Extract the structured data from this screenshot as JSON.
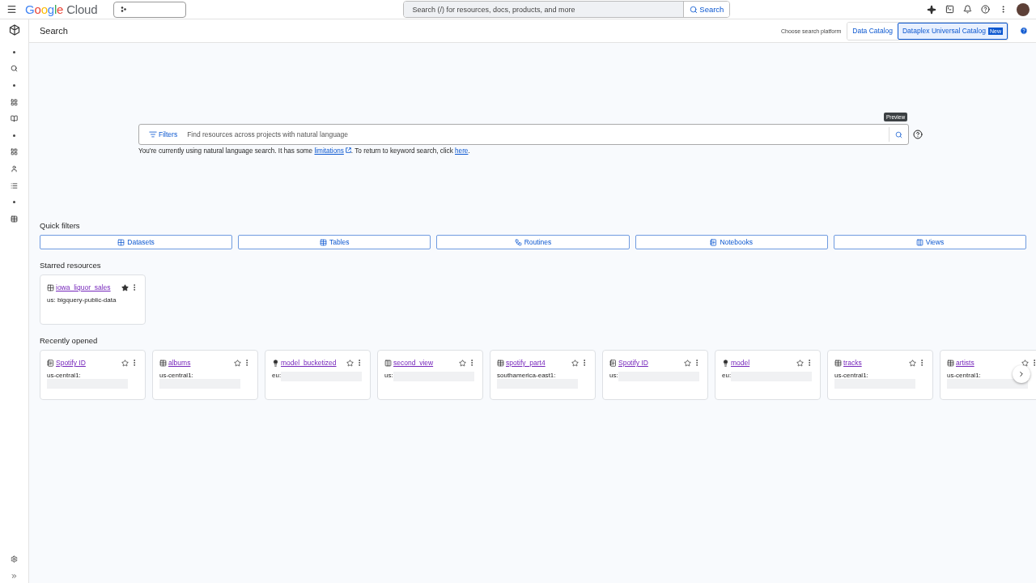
{
  "topbar": {
    "logo": [
      {
        "text": "G",
        "color": "#4285f4"
      },
      {
        "text": "o",
        "color": "#ea4335"
      },
      {
        "text": "o",
        "color": "#fbbc04"
      },
      {
        "text": "g",
        "color": "#4285f4"
      },
      {
        "text": "l",
        "color": "#34a853"
      },
      {
        "text": "e",
        "color": "#ea4335"
      }
    ],
    "logo_suffix": "Cloud",
    "search_placeholder": "Search (/) for resources, docs, products, and more",
    "search_button": "Search"
  },
  "sidebar": [
    {
      "kind": "dot"
    },
    {
      "kind": "search"
    },
    {
      "kind": "dot"
    },
    {
      "kind": "grid"
    },
    {
      "kind": "book"
    },
    {
      "kind": "dot"
    },
    {
      "kind": "grid"
    },
    {
      "kind": "person"
    },
    {
      "kind": "list"
    },
    {
      "kind": "dot"
    },
    {
      "kind": "table"
    }
  ],
  "header": {
    "title": "Search",
    "platform_label": "Choose search platform",
    "platforms": [
      {
        "label": "Data Catalog",
        "selected": false
      },
      {
        "label": "Dataplex Universal Catalog",
        "selected": true,
        "badge": "New"
      }
    ]
  },
  "search": {
    "tooltip": "Preview",
    "filters_label": "Filters",
    "placeholder": "Find resources across projects with natural language",
    "note_before": "You're currently using natural language search. It has some ",
    "note_link": "limitations",
    "note_middle": ". To return to keyword search, click ",
    "note_link2": "here",
    "note_after": "."
  },
  "quick_filters": {
    "title": "Quick filters",
    "items": [
      {
        "label": "Datasets",
        "kind": "dataset"
      },
      {
        "label": "Tables",
        "kind": "table"
      },
      {
        "label": "Routines",
        "kind": "routine"
      },
      {
        "label": "Notebooks",
        "kind": "notebook"
      },
      {
        "label": "Views",
        "kind": "view"
      }
    ]
  },
  "starred": {
    "title": "Starred resources",
    "items": [
      {
        "name": "iowa_liquor_sales",
        "kind": "dataset",
        "starred": true,
        "location": "us: bigquery-public-data"
      }
    ]
  },
  "recent": {
    "title": "Recently opened",
    "items": [
      {
        "name": "Spotify ID",
        "kind": "notebook",
        "starred": false,
        "location": "us-central1:"
      },
      {
        "name": "albums",
        "kind": "table",
        "starred": false,
        "location": "us-central1:"
      },
      {
        "name": "model_bucketized",
        "kind": "model",
        "starred": false,
        "location": "eu:"
      },
      {
        "name": "second_view",
        "kind": "view",
        "starred": false,
        "location": "us:"
      },
      {
        "name": "spotify_part4",
        "kind": "table",
        "starred": false,
        "location": "southamerica-east1:"
      },
      {
        "name": "Spotify ID",
        "kind": "notebook",
        "starred": false,
        "location": "us:"
      },
      {
        "name": "model",
        "kind": "model",
        "starred": false,
        "location": "eu:"
      },
      {
        "name": "tracks",
        "kind": "table",
        "starred": false,
        "location": "us-central1:"
      },
      {
        "name": "artists",
        "kind": "table",
        "starred": false,
        "location": "us-central1:"
      }
    ]
  }
}
